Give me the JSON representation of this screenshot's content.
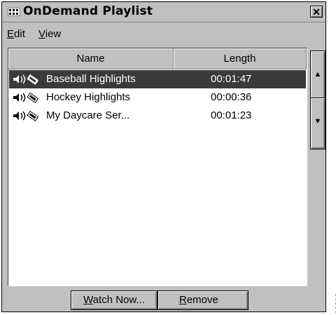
{
  "window": {
    "title": "OnDemand Playlist",
    "close_label": "✕"
  },
  "menu": [
    {
      "accel": "E",
      "rest": "dit"
    },
    {
      "accel": "V",
      "rest": "iew"
    }
  ],
  "columns": {
    "name": "Name",
    "length": "Length"
  },
  "rows": [
    {
      "name": "Baseball Highlights",
      "length": "00:01:47",
      "selected": true,
      "icon": "speaker-tape-icon"
    },
    {
      "name": "Hockey Highlights",
      "length": "00:00:36",
      "selected": false,
      "icon": "speaker-tape-icon"
    },
    {
      "name": "My Daycare Ser...",
      "length": "00:01:23",
      "selected": false,
      "icon": "speaker-tape-icon"
    }
  ],
  "buttons": {
    "watch_accel": "W",
    "watch_rest": "atch Now...",
    "remove_accel": "R",
    "remove_rest": "emove",
    "up_arrow": "▲",
    "down_arrow": "▼"
  },
  "document_id": "22833",
  "colors": {
    "window_bg": "#c0c0c0",
    "selected_row": "#3a3a3a"
  }
}
